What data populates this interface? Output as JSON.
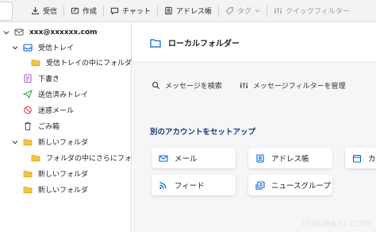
{
  "toolbar": {
    "get_messages": "受信",
    "write": "作成",
    "chat": "チャット",
    "address_book": "アドレス帳",
    "tag": "タグ",
    "quick_filter": "クイックフィルター"
  },
  "folders": {
    "account": "xxx@xxxxxx.com",
    "inbox": "受信トレイ",
    "inbox_sub": "受信トレイの中にフォルダ",
    "drafts": "下書き",
    "sent": "送信済みトレイ",
    "junk": "迷惑メール",
    "trash": "ごみ箱",
    "new_folder1": "新しいフォルダ",
    "nested": "フォルダの中にさらにフォルダ",
    "new_folder2": "新しいフォルダ",
    "new_folder3": "新しいフォルダ"
  },
  "main": {
    "header_title": "ローカルフォルダー",
    "search_messages": "メッセージを検索",
    "manage_filters": "メッセージフィルターを管理",
    "setup_title": "別のアカウントをセットアップ",
    "cards": {
      "mail": "メール",
      "address_book": "アドレス帳",
      "calendar_cut": "カ",
      "feed": "フィード",
      "newsgroup": "ニュースグループ"
    }
  },
  "watermark": "inoueani.com",
  "colors": {
    "folder_yellow": "#f5c542",
    "accent_blue": "#0060df",
    "drafts_purple": "#a35fd6",
    "sent_green": "#2fa84f",
    "junk_red": "#e0404a",
    "heading_navy": "#1a3a7a"
  },
  "icons": {
    "get_messages": "download-icon",
    "write": "pencil-icon",
    "chat": "chat-bubble-icon",
    "address_book": "address-book-icon",
    "tag": "tag-icon",
    "quick_filter": "filter-icon"
  }
}
